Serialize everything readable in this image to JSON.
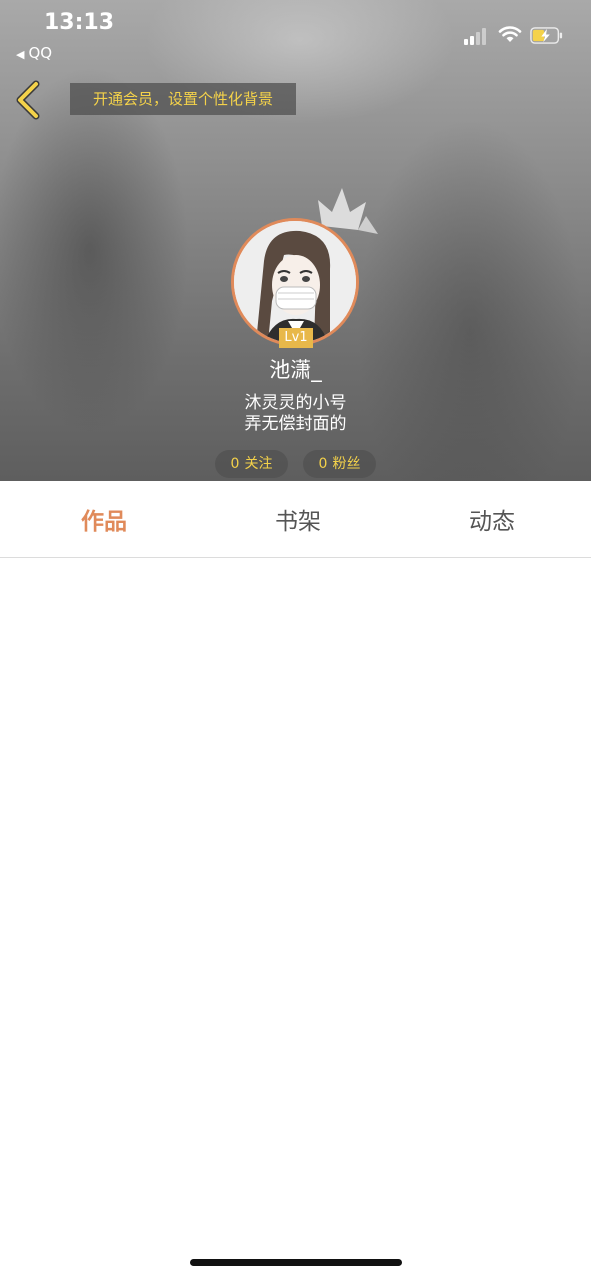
{
  "status_bar": {
    "time": "13:13",
    "back_app": "QQ"
  },
  "header": {
    "vip_banner": "开通会员，设置个性化背景",
    "level_badge": "Lv1",
    "username": "池潇_",
    "bio_line1": "沐灵灵的小号",
    "bio_line2": "弄无偿封面的",
    "following": {
      "count": "0",
      "label": "关注"
    },
    "followers": {
      "count": "0",
      "label": "粉丝"
    }
  },
  "tabs": [
    {
      "label": "作品",
      "active": true
    },
    {
      "label": "书架",
      "active": false
    },
    {
      "label": "动态",
      "active": false
    }
  ],
  "colors": {
    "accent": "#e08a5a",
    "gold": "#f4d24a",
    "level": "#e8b84a"
  },
  "icons": [
    "back-chevron-icon",
    "signal-icon",
    "wifi-icon",
    "battery-charging-icon",
    "crown-icon"
  ]
}
